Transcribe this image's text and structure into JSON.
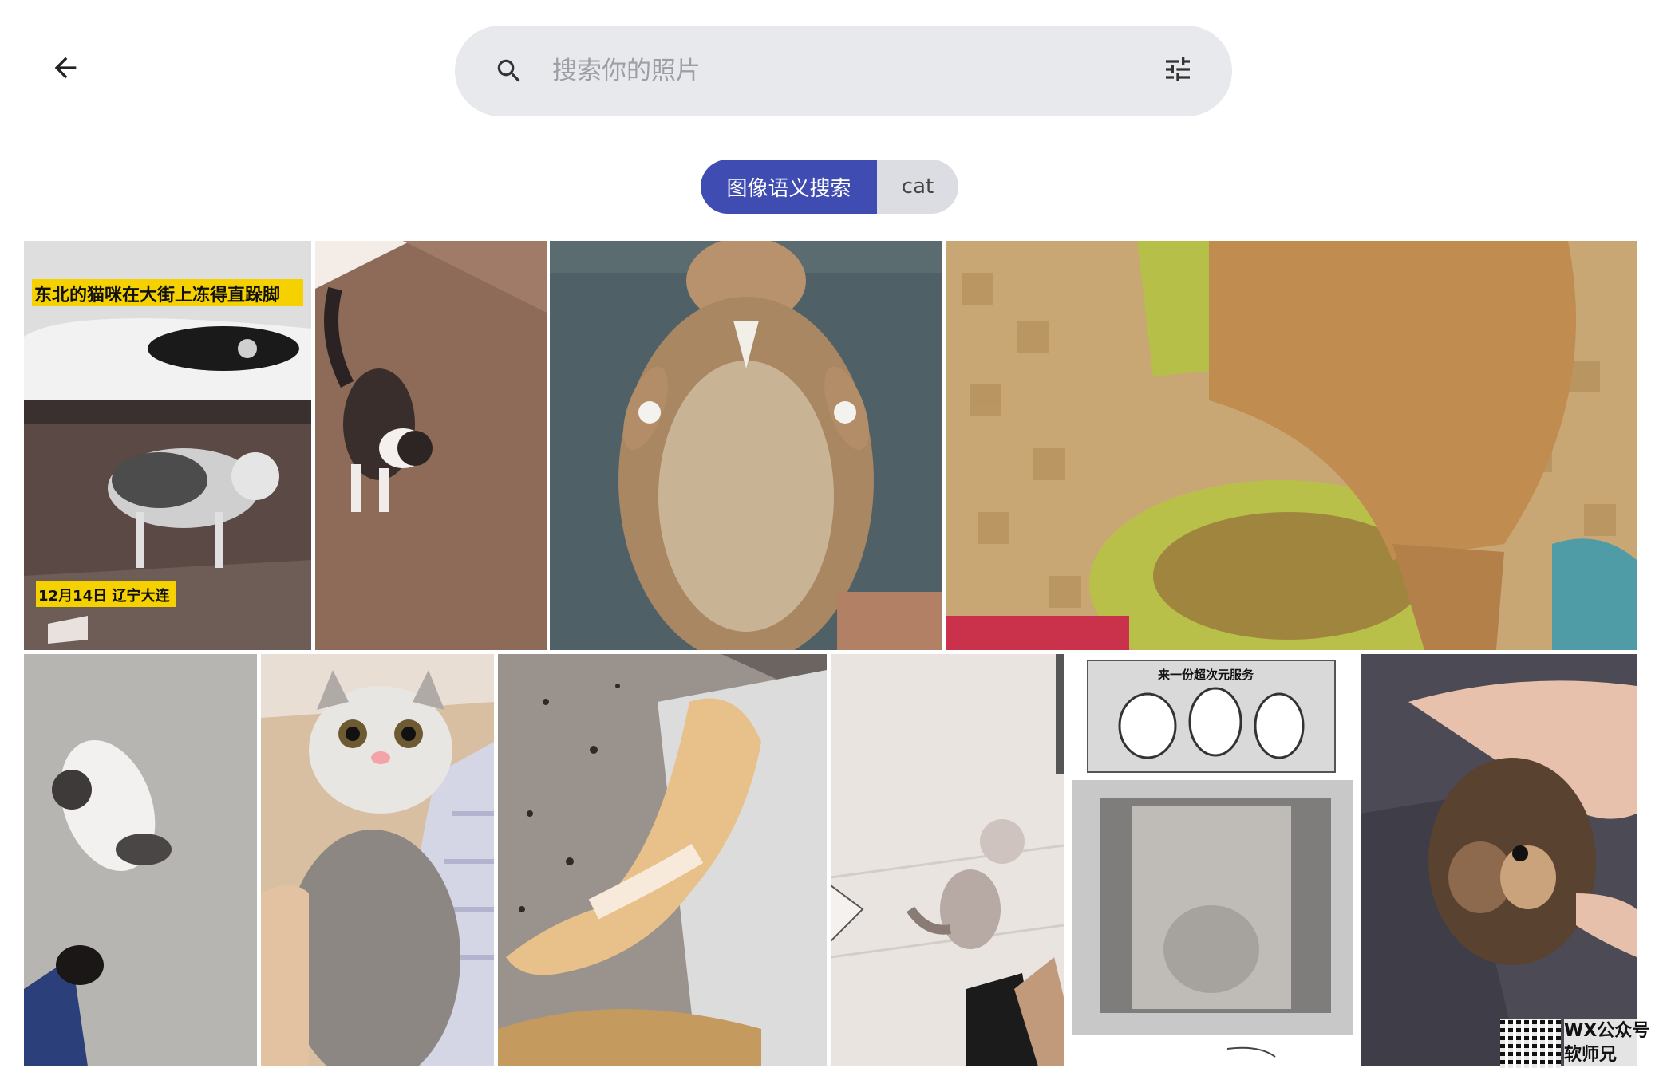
{
  "header": {
    "back_icon": "arrow-left-icon",
    "search": {
      "icon": "search-icon",
      "placeholder": "搜索你的照片",
      "value": "",
      "filter_icon": "tune-icon"
    }
  },
  "chips": {
    "mode_label": "图像语义搜索",
    "query_label": "cat"
  },
  "colors": {
    "accent": "#3f4cb1",
    "search_bg": "#e8e9ec",
    "chip_bg": "#dcdde2"
  },
  "photos": {
    "p1": {
      "caption_top": "东北的猫咪在大街上冻得直跺脚",
      "caption_bottom": "12月14日 辽宁大连"
    },
    "p9": {
      "comic_title": "来一份超次元服务"
    }
  },
  "watermark": {
    "line1": "WX公众号",
    "line2": "软师兄"
  }
}
